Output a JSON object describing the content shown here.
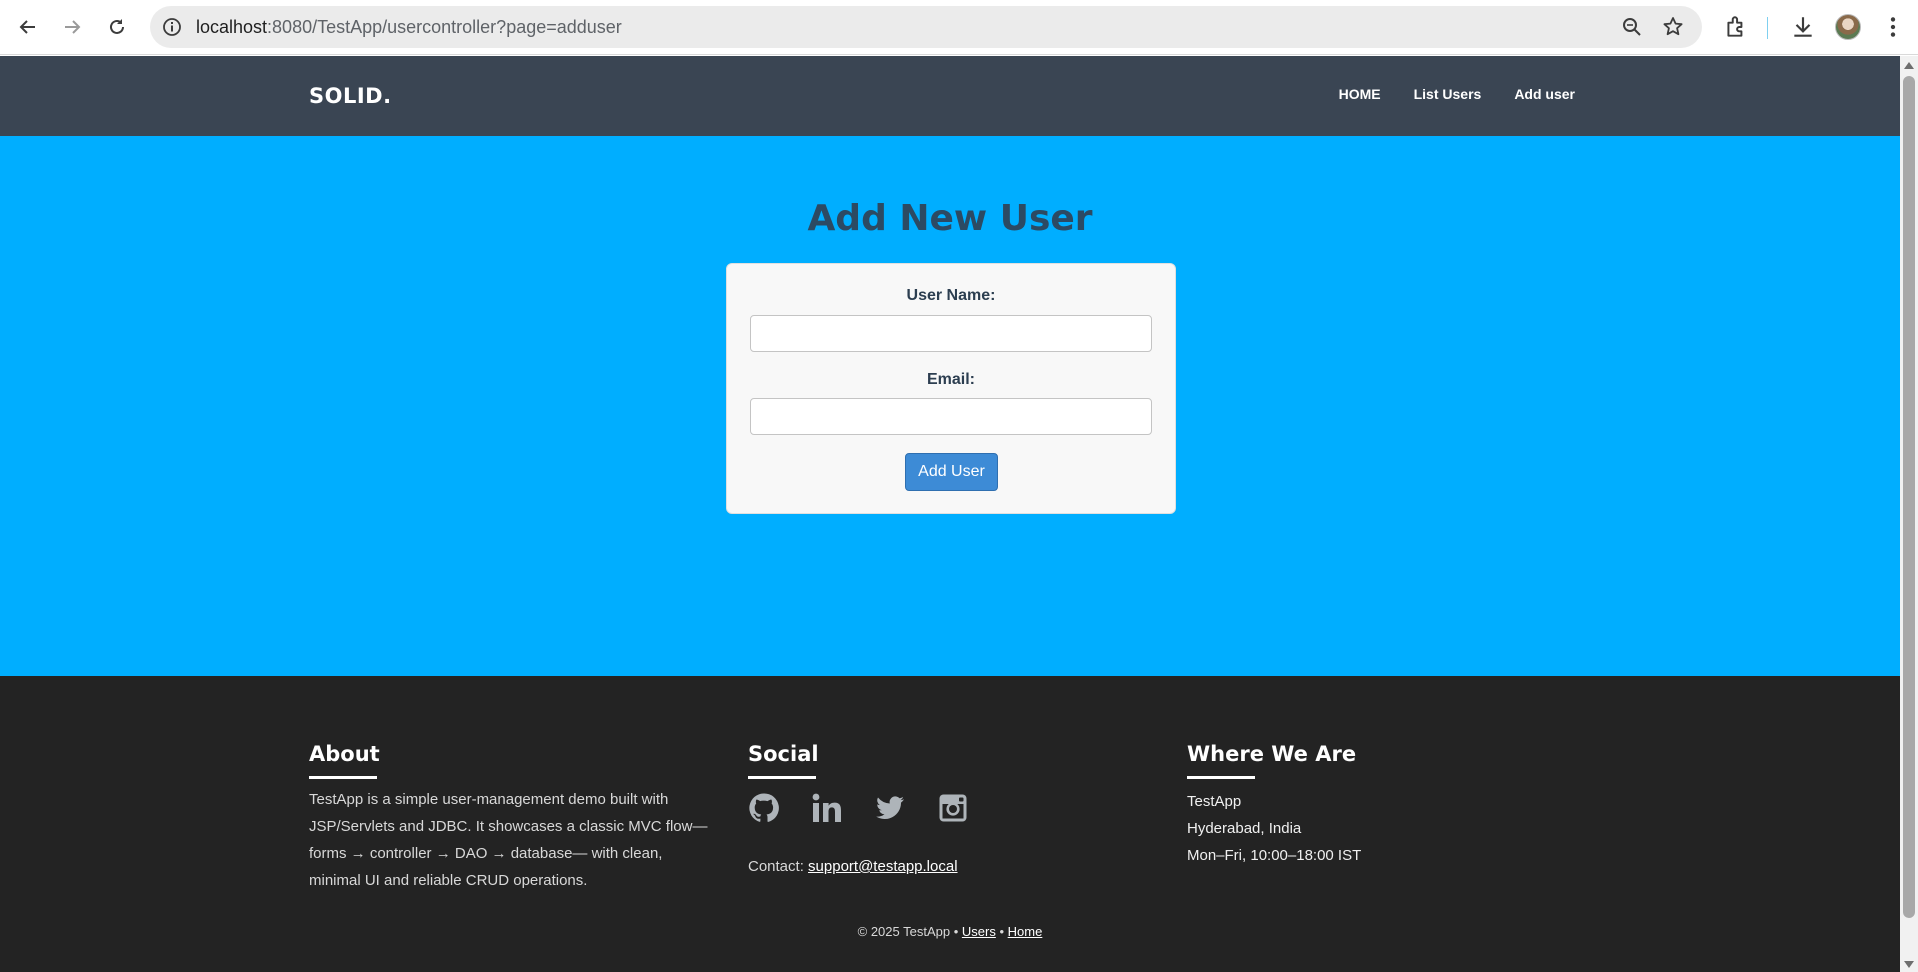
{
  "browser": {
    "url_host": "localhost",
    "url_rest": ":8080/TestApp/usercontroller?page=adduser"
  },
  "site": {
    "logo": "SOLID.",
    "nav": [
      "HOME",
      "List Users",
      "Add user"
    ]
  },
  "form": {
    "title": "Add New User",
    "username_label": "User Name:",
    "username_value": "",
    "email_label": "Email:",
    "email_value": "",
    "submit_label": "Add User"
  },
  "footer": {
    "about_title": "About",
    "about_text": "TestApp is a simple user-management demo built with JSP/Servlets and JDBC. It showcases a classic MVC flow—forms → controller → DAO → database— with clean, minimal UI and reliable CRUD operations.",
    "social_title": "Social",
    "social_icons": [
      "github-icon",
      "linkedin-icon",
      "twitter-icon",
      "instagram-icon"
    ],
    "contact_prefix": "Contact:",
    "contact_email": "support@testapp.local",
    "where_title": "Where We Are",
    "where_lines": [
      "TestApp",
      "Hyderabad, India",
      "Mon–Fri, 10:00–18:00 IST"
    ],
    "copyright": "© 2025 TestApp •",
    "link_users": "Users",
    "separator": "•",
    "link_home": "Home"
  },
  "colors": {
    "header_bg": "#3a4553",
    "hero_bg": "#00aeff",
    "footer_bg": "#232323",
    "button": "#3d8bd6"
  }
}
